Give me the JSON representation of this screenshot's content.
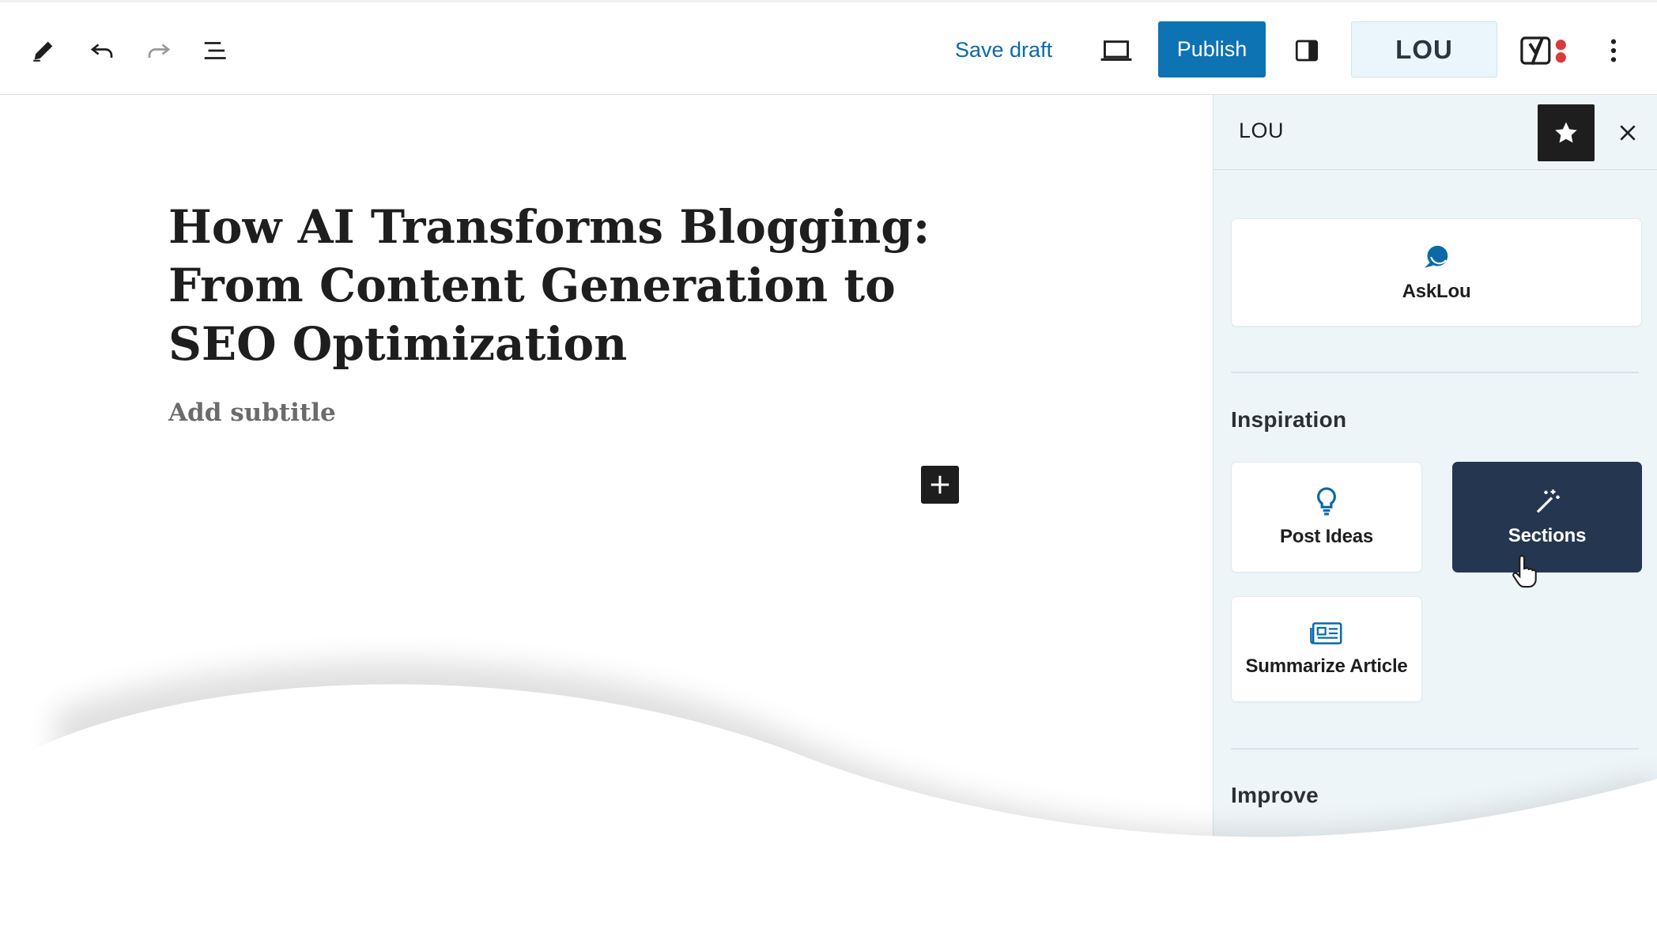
{
  "toolbar": {
    "save_draft_label": "Save draft",
    "publish_label": "Publish",
    "lou_label": "LOU",
    "icons": [
      "pencil-icon",
      "undo-icon",
      "redo-icon",
      "list-view-icon",
      "preview-laptop-icon",
      "sidebar-toggle-icon",
      "yoast-icon",
      "more-vertical-icon"
    ]
  },
  "editor": {
    "title": "How AI Transforms Blogging: From Content Generation to SEO Optimization",
    "subtitle_placeholder": "Add subtitle"
  },
  "sidebar": {
    "title": "LOU",
    "asklou_label": "AskLou",
    "inspiration_heading": "Inspiration",
    "inspiration_items": [
      {
        "label": "Post Ideas",
        "icon": "lightbulb-icon"
      },
      {
        "label": "Sections",
        "icon": "magic-wand-icon"
      },
      {
        "label": "Summarize Article",
        "icon": "newspaper-icon"
      }
    ],
    "improve_heading": "Improve"
  },
  "colors": {
    "accent_blue": "#0d73b3",
    "dark_card": "#253650",
    "sidebar_bg": "#eef5f8",
    "icon_blue": "#0b6aa6"
  }
}
